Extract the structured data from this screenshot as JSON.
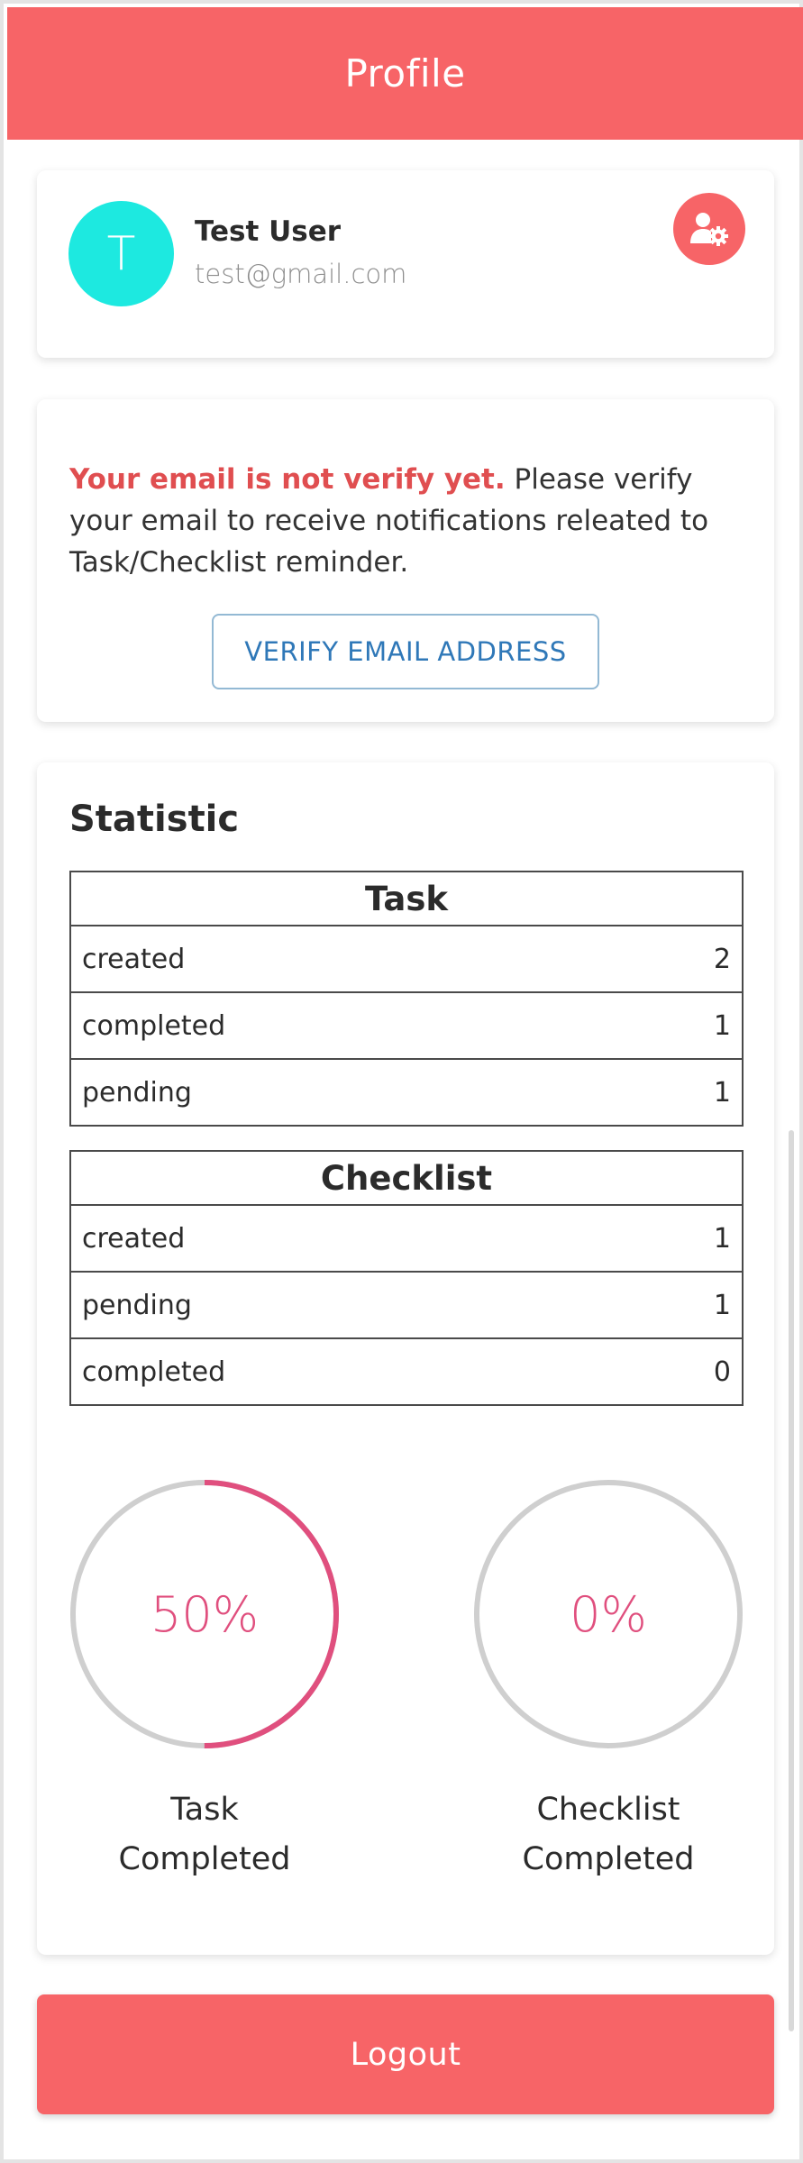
{
  "colors": {
    "brand": "#f76467",
    "avatar_bg": "#1de9e0",
    "warning": "#e04e50",
    "link_blue": "#2f78b8",
    "gauge_fill": "#e04f7e",
    "gauge_track": "#cfcfcf"
  },
  "header": {
    "title": "Profile"
  },
  "profile": {
    "avatar_initial": "T",
    "name": "Test User",
    "email": "test@gmail.com",
    "settings_icon": "user-settings-icon"
  },
  "verify": {
    "warning": "Your email is not verify yet.",
    "message": " Please verify your email to receive notifications releated to Task/Checklist reminder.",
    "button_label": "VERIFY EMAIL ADDRESS"
  },
  "statistic": {
    "title": "Statistic",
    "task": {
      "header": "Task",
      "rows": [
        {
          "label": "created",
          "value": "2"
        },
        {
          "label": "completed",
          "value": "1"
        },
        {
          "label": "pending",
          "value": "1"
        }
      ]
    },
    "checklist": {
      "header": "Checklist",
      "rows": [
        {
          "label": "created",
          "value": "1"
        },
        {
          "label": "pending",
          "value": "1"
        },
        {
          "label": "completed",
          "value": "0"
        }
      ]
    },
    "gauges": {
      "task": {
        "percent_text": "50%",
        "fraction": 0.5,
        "label_line1": "Task",
        "label_line2": "Completed"
      },
      "checklist": {
        "percent_text": "0%",
        "fraction": 0,
        "label_line1": "Checklist",
        "label_line2": "Completed"
      }
    }
  },
  "logout": {
    "label": "Logout"
  }
}
